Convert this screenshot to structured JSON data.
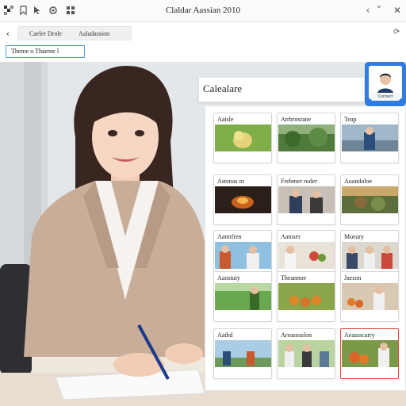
{
  "window": {
    "title": "Claldar Aassian 2010"
  },
  "toolbar": {
    "breadcrumb_a": "Caeler Drole",
    "breadcrumb_b": "Aaladassion"
  },
  "theme_input": {
    "value": "Theme o Thaeme l"
  },
  "calendar": {
    "title": "Calealare",
    "tiles": [
      {
        "label": "Aaisle",
        "scene": "plant"
      },
      {
        "label": "Atrbrosrane",
        "scene": "forest"
      },
      {
        "label": "Teap",
        "scene": "person-outdoor"
      },
      {
        "label": "Astenas or",
        "scene": "fire"
      },
      {
        "label": "Frebmer roder",
        "scene": "couple"
      },
      {
        "label": "Auandoloe",
        "scene": "garden"
      },
      {
        "label": "Aatmfren",
        "scene": "people-blue"
      },
      {
        "label": "Aatoser",
        "scene": "people-cafe"
      },
      {
        "label": "Moeary",
        "scene": "people-three"
      },
      {
        "label": "Aaostuty",
        "scene": "farm"
      },
      {
        "label": "Theanmer",
        "scene": "orange-field"
      },
      {
        "label": "Jaeson",
        "scene": "fruit-stand"
      },
      {
        "label": "Aatbd",
        "scene": "beach"
      },
      {
        "label": "Areasosslon",
        "scene": "group"
      },
      {
        "label": "Aeassscarry",
        "scene": "harvest",
        "active": true
      }
    ]
  },
  "profile": {
    "button_label": "Connect"
  },
  "colors": {
    "accent_blue": "#2f7de1",
    "input_border": "#5b9bd5",
    "active_tile_border": "#e04a3a"
  },
  "icons": [
    "app-logo-icon",
    "bookmark-icon",
    "cursor-icon",
    "settings-icon",
    "grid-icon",
    "chevron-left-icon",
    "chevron-down-icon",
    "close-icon",
    "back-arrow-icon",
    "refresh-icon"
  ]
}
